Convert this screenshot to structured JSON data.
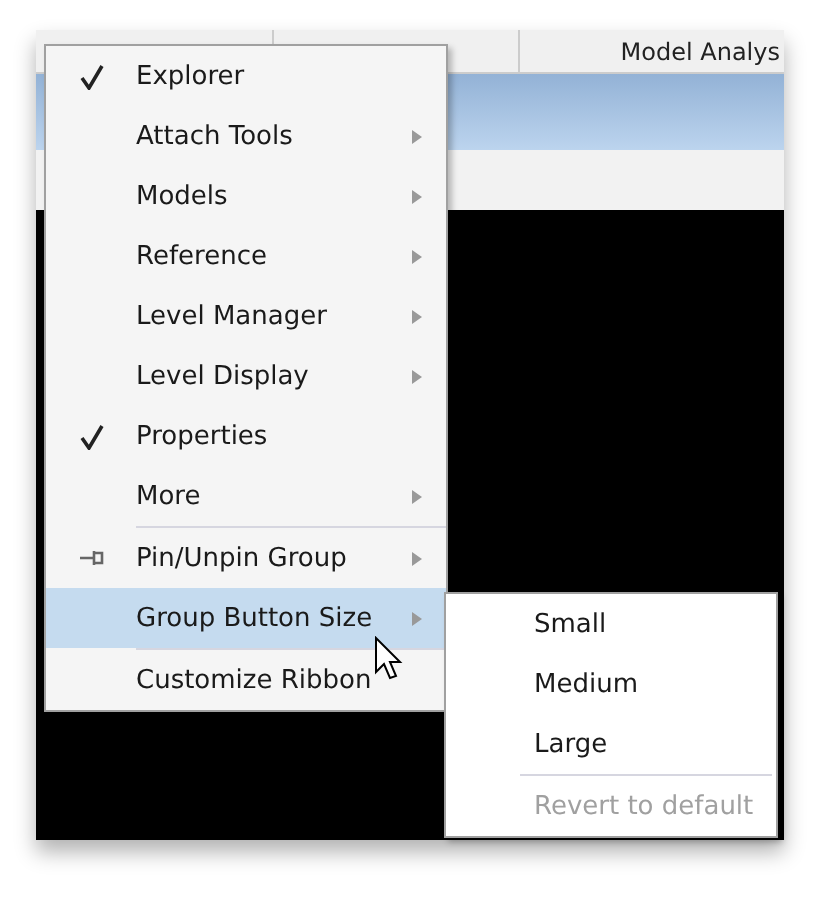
{
  "tab_bar": {
    "tabs": [
      {
        "label": "Model Analys",
        "selected": false
      }
    ]
  },
  "context_menu": {
    "groups": [
      {
        "items": [
          {
            "label": "Explorer",
            "kind": "toggle",
            "checked": true,
            "highlighted": false
          },
          {
            "label": "Attach Tools",
            "kind": "submenu",
            "highlighted": false
          },
          {
            "label": "Models",
            "kind": "submenu",
            "highlighted": false
          },
          {
            "label": "Reference",
            "kind": "submenu",
            "highlighted": false
          },
          {
            "label": "Level Manager",
            "kind": "submenu",
            "highlighted": false
          },
          {
            "label": "Level Display",
            "kind": "submenu",
            "highlighted": false
          },
          {
            "label": "Properties",
            "kind": "toggle",
            "checked": true,
            "highlighted": false
          },
          {
            "label": "More",
            "kind": "submenu",
            "highlighted": false
          }
        ]
      },
      {
        "items": [
          {
            "label": "Pin/Unpin Group",
            "kind": "pin",
            "highlighted": false
          },
          {
            "label": "Group Button Size",
            "kind": "submenu",
            "highlighted": true
          }
        ]
      },
      {
        "items": [
          {
            "label": "Customize Ribbon",
            "kind": "command",
            "highlighted": false
          }
        ]
      }
    ]
  },
  "submenu": {
    "groups": [
      {
        "items": [
          {
            "label": "Small",
            "disabled": false
          },
          {
            "label": "Medium",
            "disabled": false
          },
          {
            "label": "Large",
            "disabled": false
          }
        ]
      },
      {
        "items": [
          {
            "label": "Revert to default",
            "disabled": true
          }
        ]
      }
    ]
  }
}
